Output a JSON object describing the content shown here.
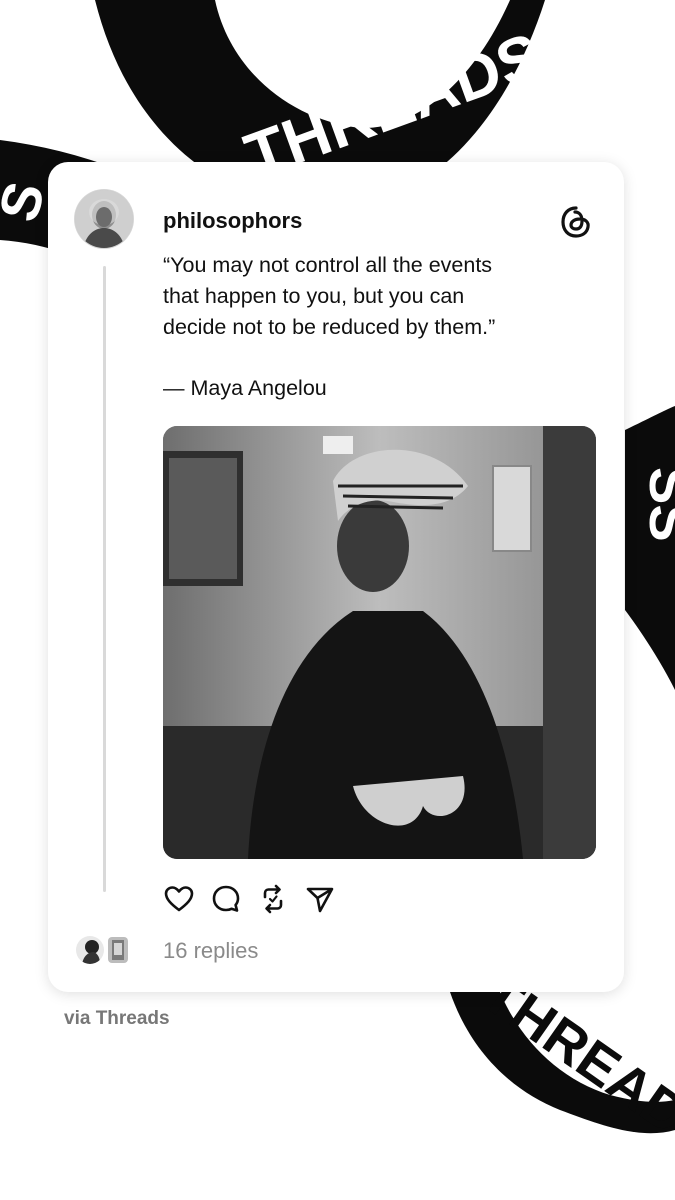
{
  "ribbons": {
    "top_text": "THREADS",
    "top_left_text": "S",
    "right_text": "SS",
    "bottom_text": "THREADS"
  },
  "post": {
    "username": "philosophors",
    "quote": "“You may not control all the events\nthat happen to you, but you can\ndecide not to be reduced by them.”",
    "attribution": "— Maya Angelou",
    "replies": "16 replies"
  },
  "icons": {
    "brand": "threads-logo-icon",
    "like": "heart-icon",
    "comment": "comment-bubble-icon",
    "repost": "repost-icon",
    "share": "send-icon"
  },
  "footer": {
    "via": "via Threads"
  },
  "colors": {
    "ribbon": "#0b0b0b",
    "card": "#ffffff",
    "text": "#111111",
    "muted": "#8a8a8a"
  }
}
